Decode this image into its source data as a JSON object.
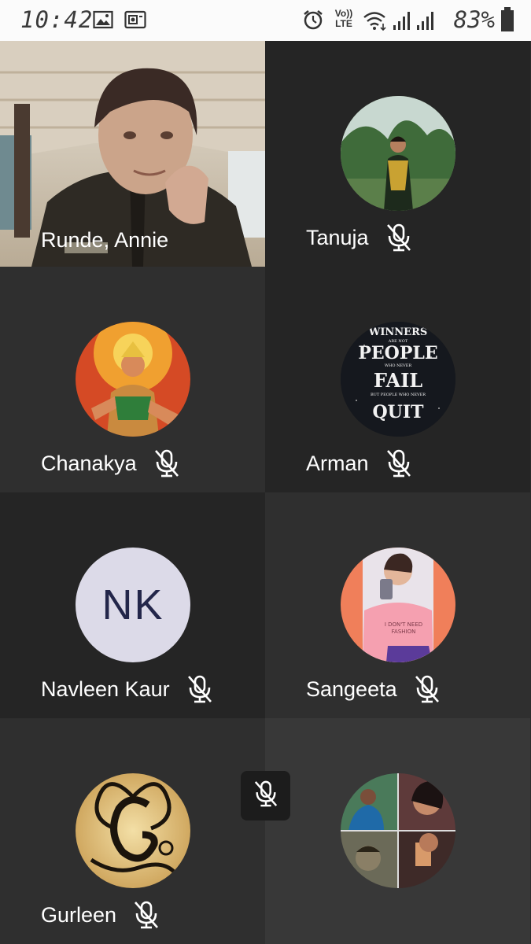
{
  "status_bar": {
    "time": "10:42",
    "battery_percent": "83%",
    "network_label_top": "Vo))",
    "network_label_bottom": "LTE",
    "icons": [
      "gallery-icon",
      "screen-record-icon",
      "alarm-icon",
      "volte-icon",
      "wifi-icon",
      "signal-icon",
      "signal-icon",
      "battery-icon"
    ]
  },
  "participants": [
    {
      "name": "Runde, Annie",
      "type": "video",
      "muted": false
    },
    {
      "name": "Tanuja",
      "type": "photo",
      "muted": true
    },
    {
      "name": "Chanakya",
      "type": "photo",
      "muted": true
    },
    {
      "name": "Arman",
      "type": "photo",
      "muted": true
    },
    {
      "name": "Navleen Kaur",
      "type": "initials",
      "initials": "NK",
      "muted": true
    },
    {
      "name": "Sangeeta",
      "type": "photo",
      "muted": true
    },
    {
      "name": "Gurleen",
      "type": "photo",
      "muted": true
    },
    {
      "name": "",
      "type": "photo",
      "muted": false
    }
  ],
  "avatar_text": {
    "arman": [
      "WINNERS",
      "ARE NOT",
      "PEOPLE",
      "WHO NEVER",
      "FAIL",
      "BUT PEOPLE WHO NEVER",
      "QUIT"
    ],
    "sangeeta_shirt": [
      "I DON'T NEED",
      "FASHION"
    ]
  },
  "controls": {
    "self_mute_icon": "mic-off-icon"
  },
  "colors": {
    "tile_dark": "#252525",
    "tile_mid": "#2f2f2f",
    "tile_light": "#383838",
    "initials_bg": "#dcdae8",
    "initials_text": "#23264a"
  }
}
